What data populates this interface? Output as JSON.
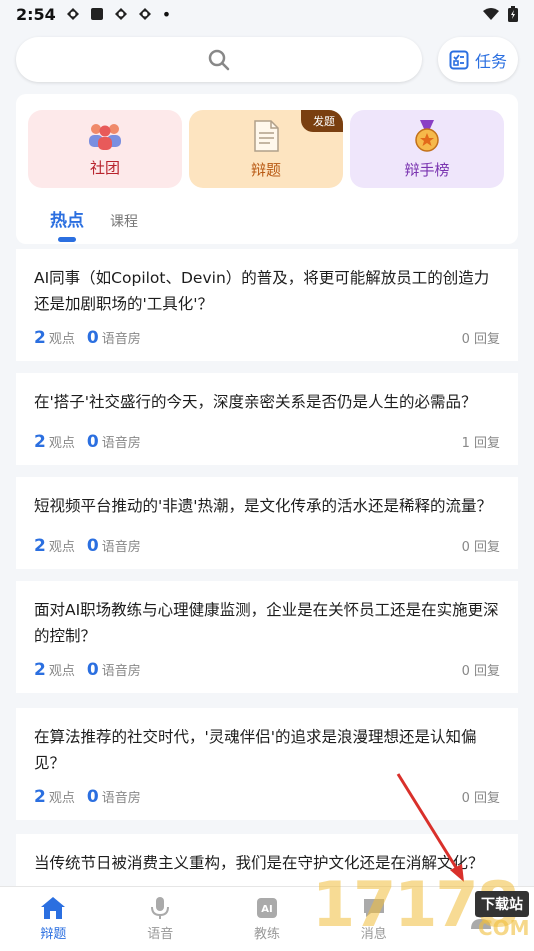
{
  "status": {
    "time": "2:54",
    "dot": "•"
  },
  "header": {
    "task_label": "任务"
  },
  "categories": [
    {
      "label": "社团"
    },
    {
      "label": "辩题",
      "badge": "发题"
    },
    {
      "label": "辩手榜"
    }
  ],
  "tabs": [
    {
      "label": "热点"
    },
    {
      "label": "课程"
    }
  ],
  "posts": [
    {
      "title": "AI同事（如Copilot、Devin）的普及，将更可能解放员工的创造力还是加剧职场的'工具化'？",
      "views": "2",
      "views_label": "观点",
      "rooms": "0",
      "rooms_label": "语音房",
      "replies": "0 回复"
    },
    {
      "title": "在'搭子'社交盛行的今天，深度亲密关系是否仍是人生的必需品？",
      "views": "2",
      "views_label": "观点",
      "rooms": "0",
      "rooms_label": "语音房",
      "replies": "1 回复"
    },
    {
      "title": "短视频平台推动的'非遗'热潮，是文化传承的活水还是稀释的流量？",
      "views": "2",
      "views_label": "观点",
      "rooms": "0",
      "rooms_label": "语音房",
      "replies": "0 回复"
    },
    {
      "title": "面对AI职场教练与心理健康监测，企业是在关怀员工还是在实施更深的控制？",
      "views": "2",
      "views_label": "观点",
      "rooms": "0",
      "rooms_label": "语音房",
      "replies": "0 回复"
    },
    {
      "title": "在算法推荐的社交时代，'灵魂伴侣'的追求是浪漫理想还是认知偏见？",
      "views": "2",
      "views_label": "观点",
      "rooms": "0",
      "rooms_label": "语音房",
      "replies": "0 回复"
    },
    {
      "title": "当传统节日被消费主义重构，我们是在守护文化还是在消解文化？"
    }
  ],
  "tabbar": [
    {
      "label": "辩题"
    },
    {
      "label": "语音"
    },
    {
      "label": "教练"
    },
    {
      "label": "消息"
    },
    {
      "label": ""
    }
  ],
  "watermark": {
    "digits": "17178",
    "badge": "下载站",
    "domain": "COM"
  },
  "colors": {
    "accent": "#2b6fe0",
    "background": "#f4f6f9"
  }
}
